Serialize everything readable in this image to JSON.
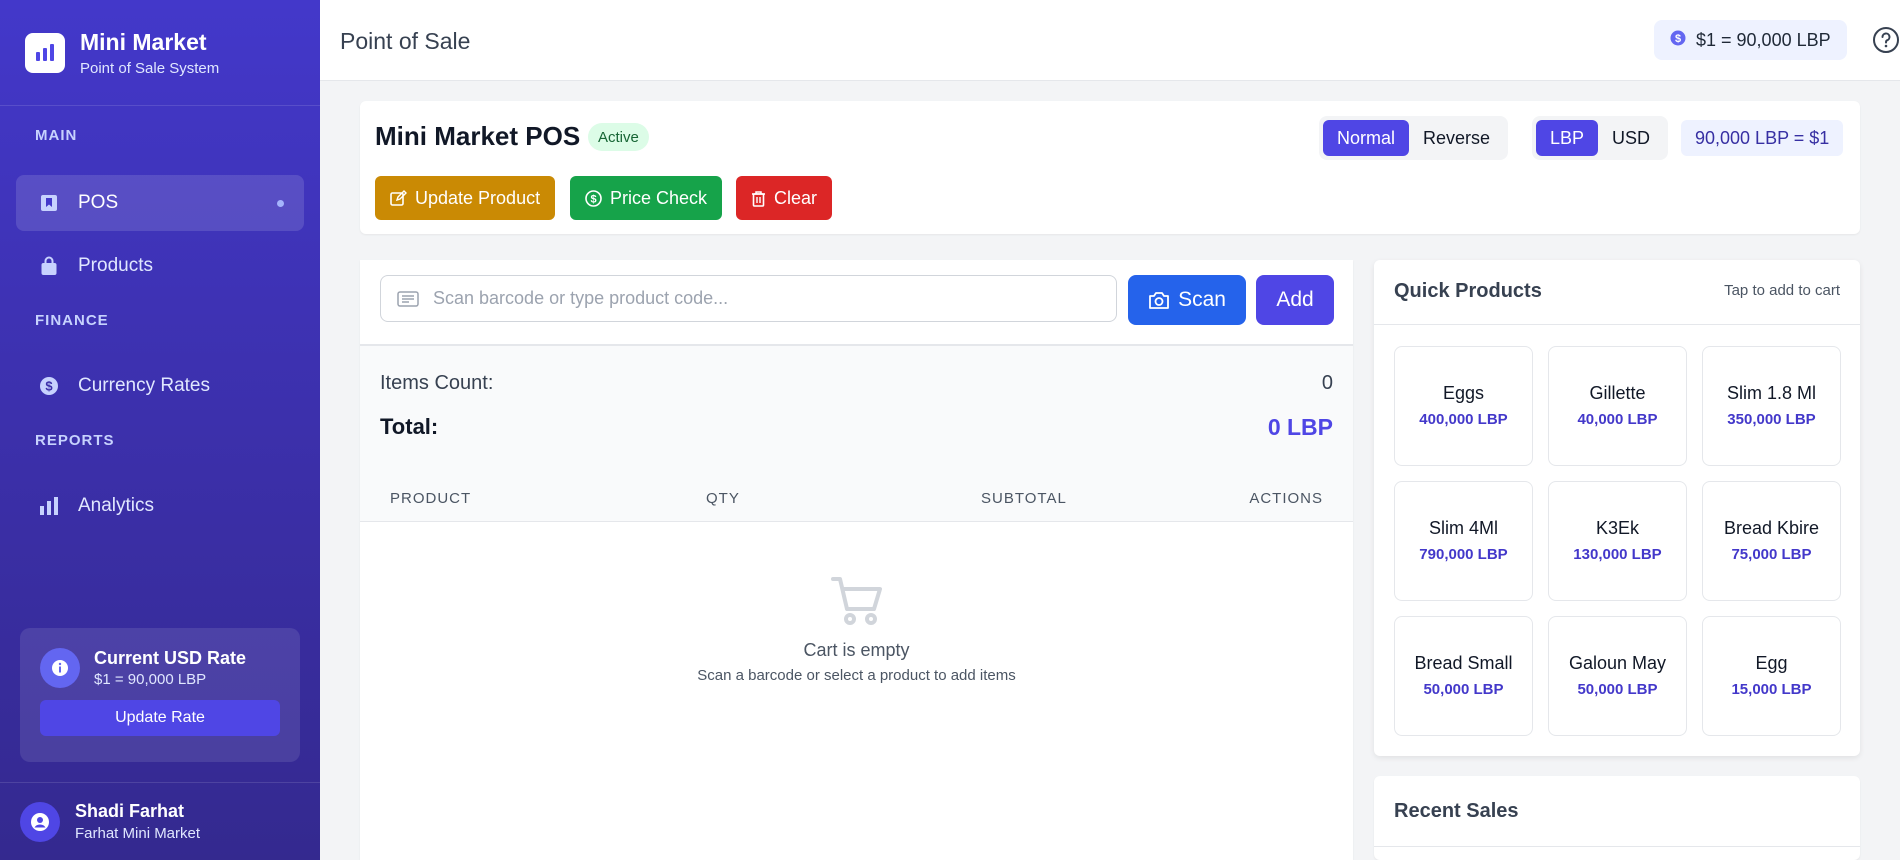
{
  "colors": {
    "accent": "#4f46e5",
    "scan": "#2563eb",
    "update": "#ca8a04",
    "price_check": "#16a34a",
    "clear": "#dc2626",
    "active_badge": "#dcfce7"
  },
  "sidebar": {
    "brand_title": "Mini Market",
    "brand_subtitle": "Point of Sale System",
    "sections": {
      "main": "MAIN",
      "finance": "FINANCE",
      "reports": "REPORTS"
    },
    "items": [
      {
        "label": "POS",
        "icon": "bookmark-icon",
        "active": true
      },
      {
        "label": "Products",
        "icon": "shopping-bag-icon"
      },
      {
        "label": "Currency Rates",
        "icon": "dollar-circle-icon"
      },
      {
        "label": "Analytics",
        "icon": "bar-chart-icon"
      }
    ],
    "rate_card": {
      "title": "Current USD Rate",
      "value": "$1 = 90,000 LBP",
      "button": "Update Rate"
    },
    "user": {
      "name": "Shadi Farhat",
      "store": "Farhat Mini Market"
    }
  },
  "header": {
    "title": "Point of Sale",
    "rate_chip": "$1 = 90,000 LBP"
  },
  "pos": {
    "title": "Mini Market POS",
    "status": "Active",
    "buttons": {
      "update": "Update Product",
      "price_check": "Price Check",
      "clear": "Clear"
    },
    "mode": {
      "normal": "Normal",
      "reverse": "Reverse",
      "selected": "Normal"
    },
    "currency": {
      "lbp": "LBP",
      "usd": "USD",
      "selected": "LBP"
    },
    "conversion": "90,000 LBP = $1"
  },
  "scan": {
    "placeholder": "Scan barcode or type product code...",
    "value": "",
    "scan_label": "Scan",
    "add_label": "Add"
  },
  "cart": {
    "items_label": "Items Count:",
    "items_value": "0",
    "total_label": "Total:",
    "total_value": "0 LBP",
    "columns": [
      "PRODUCT",
      "QTY",
      "SUBTOTAL",
      "ACTIONS"
    ],
    "empty_title": "Cart is empty",
    "empty_subtitle": "Scan a barcode or select a product to add items"
  },
  "quick_products": {
    "title": "Quick Products",
    "hint": "Tap to add to cart",
    "items": [
      {
        "name": "Eggs",
        "price": "400,000 LBP"
      },
      {
        "name": "Gillette",
        "price": "40,000 LBP"
      },
      {
        "name": "Slim 1.8 Ml",
        "price": "350,000 LBP"
      },
      {
        "name": "Slim 4Ml",
        "price": "790,000 LBP"
      },
      {
        "name": "K3Ek",
        "price": "130,000 LBP"
      },
      {
        "name": "Bread Kbire",
        "price": "75,000 LBP"
      },
      {
        "name": "Bread Small",
        "price": "50,000 LBP"
      },
      {
        "name": "Galoun May",
        "price": "50,000 LBP"
      },
      {
        "name": "Egg",
        "price": "15,000 LBP"
      }
    ]
  },
  "recent_sales": {
    "title": "Recent Sales"
  }
}
